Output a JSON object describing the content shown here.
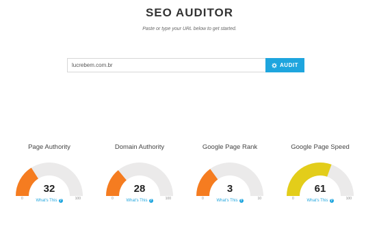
{
  "header": {
    "title": "SEO AUDITOR",
    "subtitle": "Paste or type your URL below to get started."
  },
  "search": {
    "value": "lucrebem.com.br",
    "button_label": "AUDIT",
    "button_icon": "gear-icon"
  },
  "colors": {
    "accent": "#1ea5de",
    "track": "#ebeaea",
    "orange": "#f57c20",
    "yellow": "#e3cd1a"
  },
  "gauges": [
    {
      "label": "Page Authority",
      "value": "32",
      "min": "0",
      "max": "100",
      "fraction": 0.32,
      "color": "#f57c20",
      "help": "What's This"
    },
    {
      "label": "Domain Authority",
      "value": "28",
      "min": "0",
      "max": "100",
      "fraction": 0.28,
      "color": "#f57c20",
      "help": "What's This"
    },
    {
      "label": "Google Page Rank",
      "value": "3",
      "min": "0",
      "max": "10",
      "fraction": 0.3,
      "color": "#f57c20",
      "help": "What's This"
    },
    {
      "label": "Google Page Speed",
      "value": "61",
      "min": "0",
      "max": "100",
      "fraction": 0.61,
      "color": "#e3cd1a",
      "help": "What's This"
    }
  ]
}
